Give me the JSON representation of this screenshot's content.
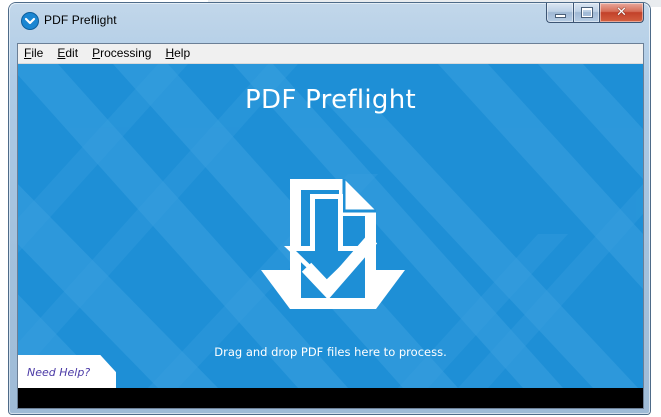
{
  "window": {
    "title": "PDF Preflight"
  },
  "menu": {
    "items": [
      {
        "mnemonic": "F",
        "rest": "ile"
      },
      {
        "mnemonic": "E",
        "rest": "dit"
      },
      {
        "mnemonic": "P",
        "rest": "rocessing"
      },
      {
        "mnemonic": "H",
        "rest": "elp"
      }
    ]
  },
  "main": {
    "title": "PDF Preflight",
    "drop_hint": "Drag and drop PDF files here to process.",
    "help_link": "Need Help?"
  },
  "icons": {
    "app": "blue-circle-chevron-icon",
    "drop": "document-download-check-icon"
  },
  "colors": {
    "background": "#1e8fd6",
    "stripes": "#3aa0e0",
    "text": "#ffffff",
    "help_link": "#4b3aa6",
    "status_bar": "#000000"
  }
}
